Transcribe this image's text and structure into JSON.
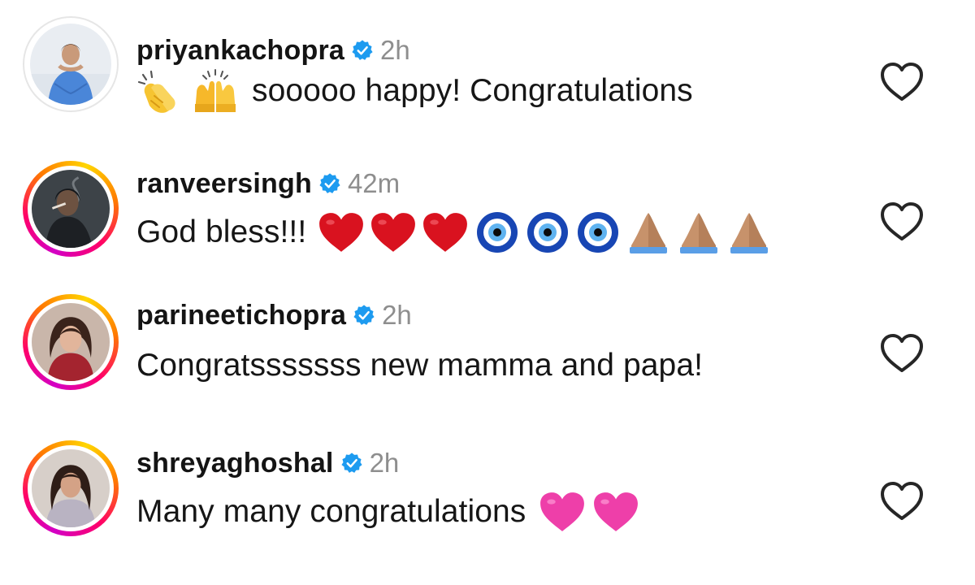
{
  "comments": [
    {
      "username": "priyankachopra",
      "time": "2h",
      "text": "sooooo happy! Congratulations",
      "emojis_before": [
        "clapping-hands",
        "raising-hands"
      ],
      "emojis_after": [],
      "story_ring": false
    },
    {
      "username": "ranveersingh",
      "time": "42m",
      "text": "God bless!!!",
      "emojis_before": [],
      "emojis_after": [
        "red-heart",
        "red-heart",
        "red-heart",
        "nazar-amulet",
        "nazar-amulet",
        "nazar-amulet",
        "folded-hands",
        "folded-hands",
        "folded-hands"
      ],
      "story_ring": true
    },
    {
      "username": "parineetichopra",
      "time": "2h",
      "text": "Congratsssssss new mamma and papa!",
      "emojis_before": [],
      "emojis_after": [],
      "story_ring": true
    },
    {
      "username": "shreyaghoshal",
      "time": "2h",
      "text": "Many many congratulations",
      "emojis_before": [],
      "emojis_after": [
        "pink-heart",
        "pink-heart"
      ],
      "story_ring": true
    }
  ],
  "colors": {
    "verified_blue": "#1d9bf0",
    "timestamp_gray": "#8e8e8e",
    "heart_outline": "#262626",
    "story_gradient": [
      "#d300c5",
      "#ff0069",
      "#ff7a00",
      "#ffd600"
    ]
  },
  "icons": {
    "verified": "verified-badge-icon",
    "like": "heart-outline-icon"
  }
}
